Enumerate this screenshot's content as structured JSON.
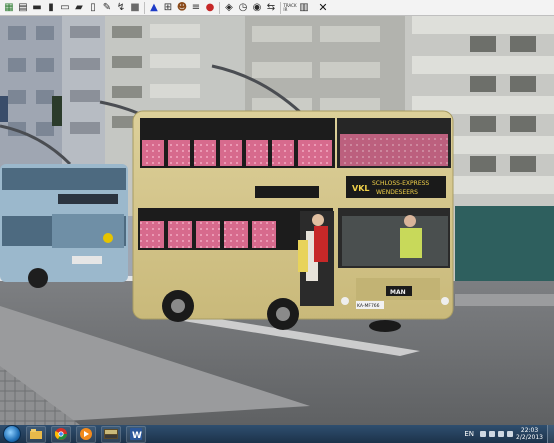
{
  "toolbar": {
    "buttons": [
      {
        "icon": "map-icon",
        "color": "#2e7d32"
      },
      {
        "icon": "grid-icon",
        "color": "#2b2b2b"
      },
      {
        "icon": "bus-icon",
        "color": "#2b2b2b"
      },
      {
        "icon": "bus-front-icon",
        "color": "#2b2b2b"
      },
      {
        "icon": "bus-side-icon",
        "color": "#2b2b2b"
      },
      {
        "icon": "truck-icon",
        "color": "#2b2b2b"
      },
      {
        "icon": "clipboard-icon",
        "color": "#2b2b2b"
      },
      {
        "icon": "tools-icon",
        "color": "#2b2b2b"
      },
      {
        "icon": "signal-icon",
        "color": "#2b2b2b"
      },
      {
        "icon": "box-icon",
        "color": "#6b6b6b"
      },
      {
        "icon": "alarm-icon",
        "color": "#1e3cc8"
      },
      {
        "icon": "bus-stop-icon",
        "color": "#2b2b2b"
      },
      {
        "icon": "people-icon",
        "color": "#8a4a1a"
      },
      {
        "icon": "road-icon",
        "color": "#2b2b2b"
      },
      {
        "icon": "traffic-icon",
        "color": "#c62828"
      },
      {
        "icon": "ticket-icon",
        "color": "#2b2b2b"
      },
      {
        "icon": "clock-icon",
        "color": "#2b2b2b"
      },
      {
        "icon": "camera-icon",
        "color": "#2b2b2b"
      },
      {
        "icon": "switch-icon",
        "color": "#2b2b2b"
      },
      {
        "icon": "track-icon",
        "color": "#2b2b2b",
        "text": "TRACK\nIR"
      },
      {
        "icon": "stats-icon",
        "color": "#2b2b2b"
      }
    ],
    "close_icon": "✕"
  },
  "bus": {
    "destination_line1": "SCHLOSS-EXPRESS",
    "destination_line2": "WENDESEERS",
    "route": "VKL",
    "brand": "MAN",
    "plate": "KA-MF766",
    "body_color": "#d8c98a"
  },
  "taskbar": {
    "apps": [
      "explorer-icon",
      "chrome-icon",
      "media-player-icon",
      "omsi-icon",
      "word-icon"
    ],
    "language": "EN",
    "time": "22:03",
    "date": "2/2/2013"
  }
}
